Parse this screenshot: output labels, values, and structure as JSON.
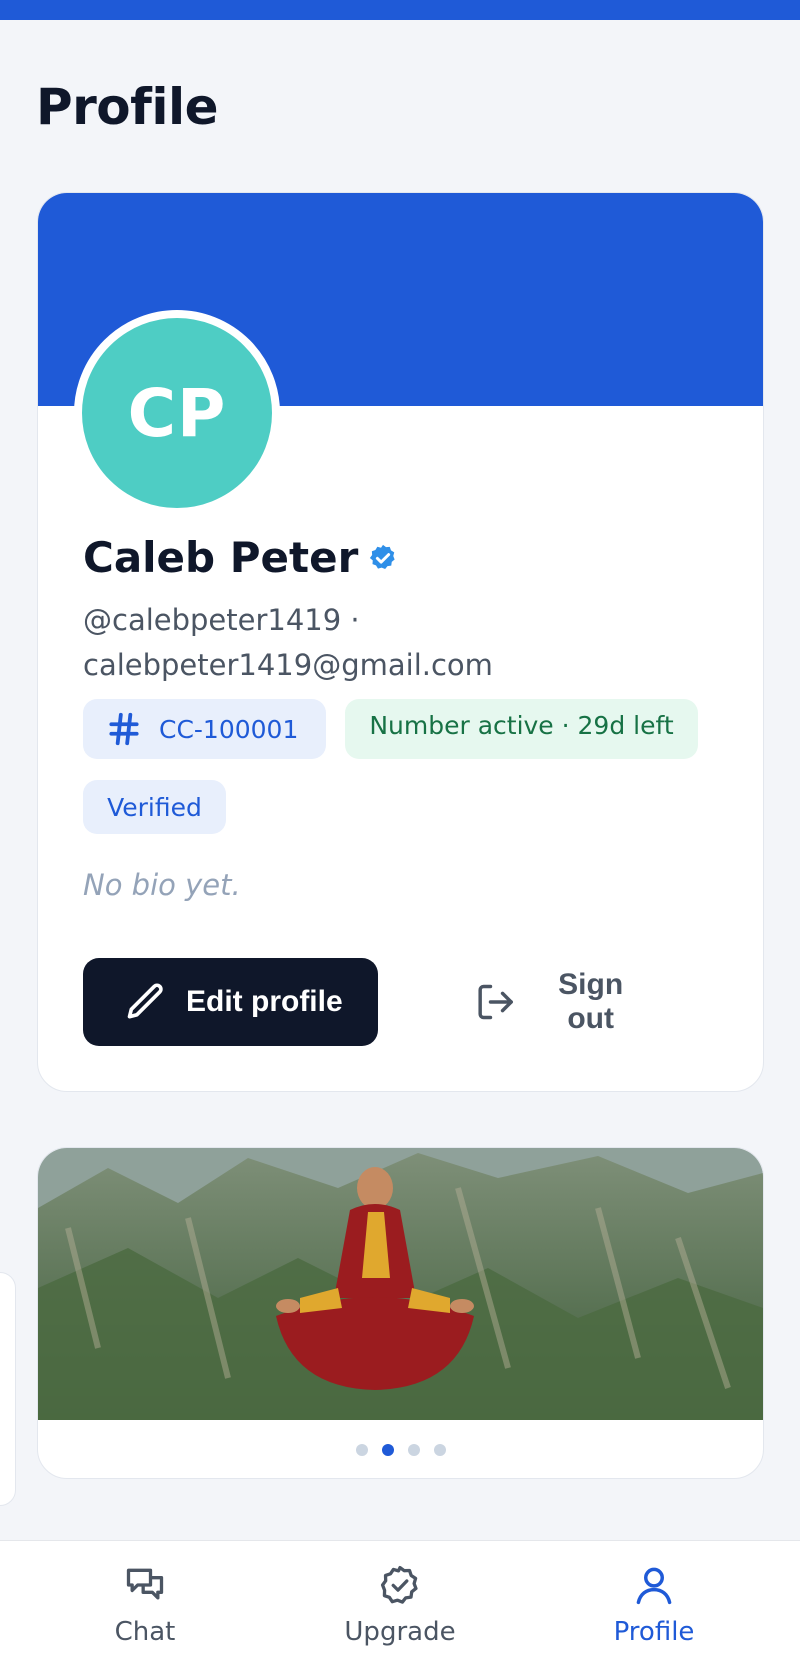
{
  "page": {
    "title": "Profile"
  },
  "colors": {
    "accent": "#1f5ad7",
    "avatar_bg": "#4ecdc4",
    "dark_button": "#0f172a",
    "success": "#177245"
  },
  "profile": {
    "initials": "CP",
    "name": "Caleb Peter",
    "verified_icon": "verified-check-icon",
    "handle": "@calebpeter1419 ·",
    "email": "calebpeter1419@gmail.com",
    "id_badge": {
      "icon": "hash-icon",
      "label": "CC-100001"
    },
    "status_badge": "Number active · 29d left",
    "verified_badge": "Verified",
    "bio": "No bio yet."
  },
  "actions": {
    "edit": {
      "label": "Edit profile",
      "icon": "pencil-icon"
    },
    "signout": {
      "label": "Sign out",
      "icon": "sign-out-icon"
    }
  },
  "carousel": {
    "slide_count": 4,
    "active_index": 1
  },
  "nav": [
    {
      "label": "Chat",
      "icon": "chat-icon",
      "active": false
    },
    {
      "label": "Upgrade",
      "icon": "badge-check-icon",
      "active": false
    },
    {
      "label": "Profile",
      "icon": "user-icon",
      "active": true
    }
  ]
}
